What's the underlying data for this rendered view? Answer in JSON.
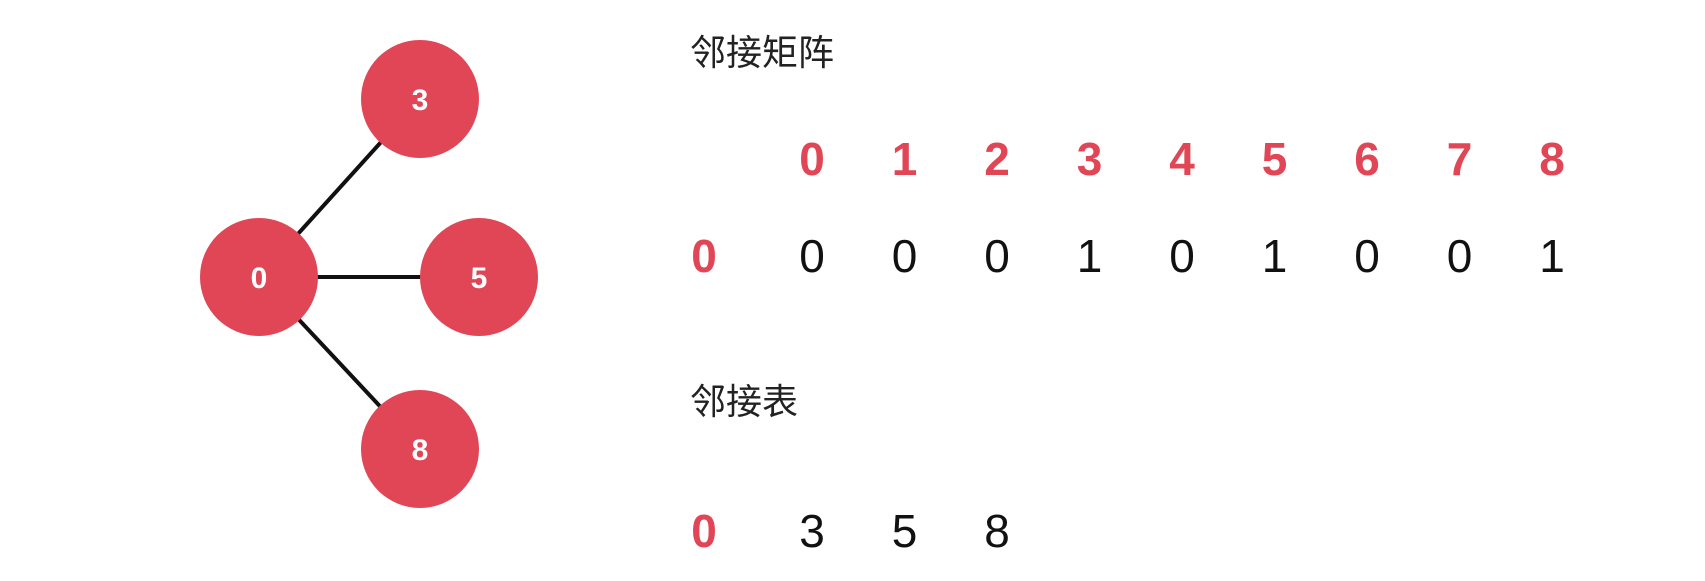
{
  "colors": {
    "node": "#e04656",
    "accent": "#e04656",
    "edge": "#111111"
  },
  "graph": {
    "nodes": [
      {
        "id": "0",
        "label": "0"
      },
      {
        "id": "3",
        "label": "3"
      },
      {
        "id": "5",
        "label": "5"
      },
      {
        "id": "8",
        "label": "8"
      }
    ],
    "edges": [
      [
        "0",
        "3"
      ],
      [
        "0",
        "5"
      ],
      [
        "0",
        "8"
      ]
    ]
  },
  "matrix": {
    "title": "邻接矩阵",
    "column_headers": [
      "0",
      "1",
      "2",
      "3",
      "4",
      "5",
      "6",
      "7",
      "8"
    ],
    "row_label": "0",
    "row_values": [
      "0",
      "0",
      "0",
      "1",
      "0",
      "1",
      "0",
      "0",
      "1"
    ]
  },
  "adjacency_list": {
    "title": "邻接表",
    "row_label": "0",
    "neighbors": [
      "3",
      "5",
      "8"
    ]
  }
}
